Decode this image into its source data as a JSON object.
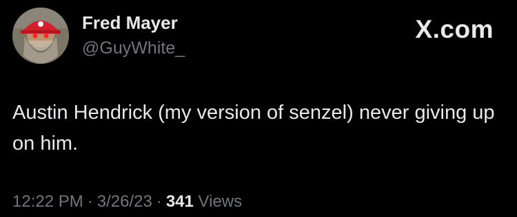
{
  "author": {
    "display_name": "Fred Mayer",
    "handle": "@GuyWhite_",
    "avatar_icon": "bearded-man-red-cap-avatar"
  },
  "brand": {
    "label": "X.com"
  },
  "tweet": {
    "text": "Austin Hendrick (my version of senzel) never giving up on him."
  },
  "meta": {
    "time": "12:22 PM",
    "separator": "·",
    "date": "3/26/23",
    "views_count": "341",
    "views_label": "Views"
  },
  "colors": {
    "background": "#000000",
    "primary_text": "#e7e9ea",
    "secondary_text": "#71767b",
    "cap_red": "#d5202c"
  }
}
